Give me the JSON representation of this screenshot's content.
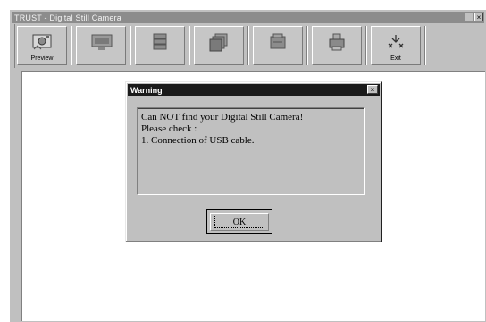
{
  "window": {
    "title": "TRUST - Digital Still Camera",
    "controls": [
      "_",
      "×"
    ]
  },
  "toolbar": {
    "buttons": [
      {
        "name": "preview-button",
        "icon": "camera-preview-icon",
        "label": "Preview"
      },
      {
        "name": "capture-button",
        "icon": "monitor-icon",
        "label": ""
      },
      {
        "name": "save-button",
        "icon": "disk-stack-icon",
        "label": ""
      },
      {
        "name": "album-button",
        "icon": "photo-stack-icon",
        "label": ""
      },
      {
        "name": "delete-button",
        "icon": "card-icon",
        "label": ""
      },
      {
        "name": "print-button",
        "icon": "printer-icon",
        "label": ""
      },
      {
        "name": "exit-button",
        "icon": "exit-arrows-icon",
        "label": "Exit"
      }
    ]
  },
  "dialog": {
    "title": "Warning",
    "close": "×",
    "message": [
      "Can NOT find your Digital Still Camera!",
      "Please check :",
      "1. Connection of USB cable."
    ],
    "ok_label": "OK"
  },
  "colors": {
    "face": "#c0c0c0",
    "dialog_title": "#1a1a1a",
    "window_title": "#8c8c8c"
  }
}
